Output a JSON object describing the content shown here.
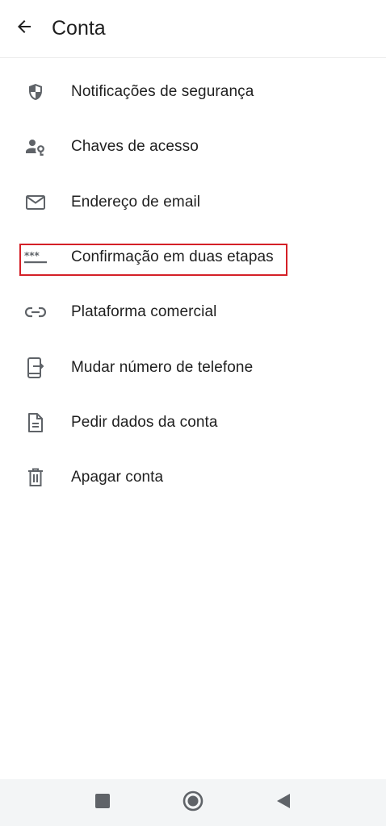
{
  "header": {
    "title": "Conta"
  },
  "menu": [
    {
      "label": "Notificações de segurança",
      "icon": "shield-icon"
    },
    {
      "label": "Chaves de acesso",
      "icon": "person-key-icon"
    },
    {
      "label": "Endereço de email",
      "icon": "mail-icon"
    },
    {
      "label": "Confirmação em duas etapas",
      "icon": "password-dots-icon",
      "highlighted": true
    },
    {
      "label": "Plataforma comercial",
      "icon": "link-icon"
    },
    {
      "label": "Mudar número de telefone",
      "icon": "phone-transfer-icon"
    },
    {
      "label": "Pedir dados da conta",
      "icon": "document-icon"
    },
    {
      "label": "Apagar conta",
      "icon": "trash-icon"
    }
  ],
  "colors": {
    "icon": "#5f6368",
    "text": "#1f1f1f",
    "highlight": "#d42027",
    "navbar": "#f3f5f6",
    "nav_icon": "#5f6368"
  },
  "navigation_bar": {
    "buttons": [
      "recents-square-icon",
      "home-circle-icon",
      "back-triangle-icon"
    ]
  }
}
